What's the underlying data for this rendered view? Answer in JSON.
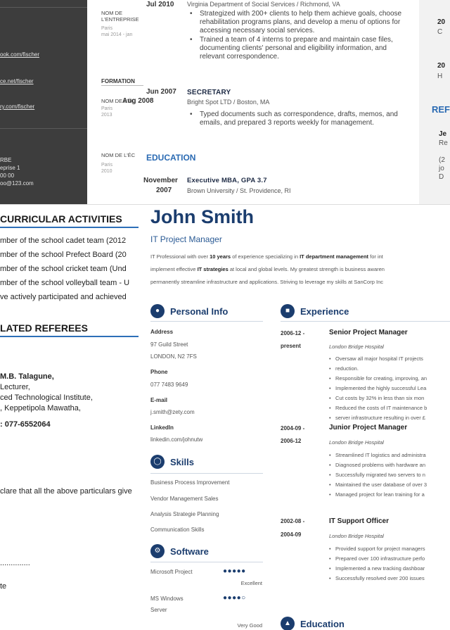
{
  "panel_a": {
    "links": [
      "ook.com/fischer",
      "ce.net/fischer",
      "ry.com/fischer"
    ],
    "address_lines": [
      "RBE",
      "eprise 1",
      "00 00",
      "oo@123.com"
    ]
  },
  "panel_b": {
    "job1": {
      "label": "NOM DE L'ENTREPRISE",
      "sub": [
        "Paris",
        "mai 2014 - jan"
      ],
      "date": "Jul 2010",
      "org": "Virginia Department of Social Services / Richmond, VA",
      "bullets": [
        "Strategized with 200+ clients to help them achieve goals, choose rehabilitation programs plans, and develop a menu of options for accessing necessary social services.",
        "Trained a team of 4 interns to prepare and maintain case files, documenting clients' personal and eligibility information, and relevant correspondence."
      ]
    },
    "formation_label": "FORMATION",
    "job2": {
      "label": "NOM DE L'ÉC",
      "sub": [
        "Paris",
        "2013"
      ],
      "date_start": "Jun 2007",
      "date_end": "Aug 2008",
      "title": "SECRETARY",
      "org": "Bright Spot LTD / Boston, MA",
      "bullets": [
        "Typed documents such as correspondence, drafts, memos, and emails, and prepared 3 reports weekly for management."
      ]
    },
    "edu": {
      "label": "NOM DE L'ÉC",
      "sub": [
        "Paris",
        "2010"
      ],
      "section": "EDUCATION",
      "date_start": "November",
      "date_end": "2007",
      "title": "Executive MBA, GPA 3.7",
      "org": "Brown University / St. Providence, RI"
    }
  },
  "panel_c": {
    "lines": [
      "20",
      "C",
      "20",
      "H",
      "REFE",
      "Je",
      "Re",
      "(2",
      "jo",
      "D"
    ]
  },
  "panel_d": {
    "activities_heading": "CURRICULAR ACTIVITIES",
    "activities": [
      "mber of the school cadet team (2012",
      "mber of the school Prefect Board (20",
      "mber of the school cricket team (Und",
      "mber of the school volleyball team - U",
      "ve actively participated and achieved"
    ],
    "referees_heading": "LATED REFEREES",
    "referee": {
      "name": "M.B. Talagune,",
      "lines": [
        "Lecturer,",
        "ced Technological Institute,",
        ", Keppetipola Mawatha,"
      ],
      "phone": ": 077-6552064"
    },
    "declaration": "clare that all the above particulars give",
    "dots": "..............",
    "date_label": "te"
  },
  "panel_e": {
    "name": "John Smith",
    "role": "IT Project Manager",
    "summary": [
      [
        "IT Professional with over ",
        "10 years",
        " of experience specializing in ",
        "IT department management",
        " for int"
      ],
      [
        "implement effective ",
        "IT strategies",
        " at local and global levels. My greatest strength is business awaren",
        "",
        ""
      ],
      [
        "permanently streamline infrastructure and applications. Striving to leverage my skills at SanCorp Inc",
        "",
        "",
        "",
        ""
      ]
    ],
    "personal": {
      "heading": "Personal Info",
      "address_label": "Address",
      "address_lines": [
        "97 Guild Street",
        "LONDON, N2 7FS"
      ],
      "phone_label": "Phone",
      "phone": "077 7483 9649",
      "email_label": "E-mail",
      "email": "j.smith@zety.com",
      "linkedin_label": "LinkedIn",
      "linkedin": "linkedin.com/johnutw"
    },
    "skills": {
      "heading": "Skills",
      "items": [
        "Business Process Improvement",
        "Vendor Management Sales",
        "Analysis Strategie Planning",
        "Communication Skills"
      ]
    },
    "software": {
      "heading": "Software",
      "items": [
        {
          "name": "Microsoft Project",
          "name2": "",
          "rating": 5,
          "level": "Excellent"
        },
        {
          "name": "MS Windows",
          "name2": "Server",
          "rating": 4,
          "level": "Very Good"
        }
      ]
    },
    "experience": {
      "heading": "Experience",
      "jobs": [
        {
          "date1": "2006-12 -",
          "date2": "present",
          "title": "Senior Project Manager",
          "company": "London Bridge Hospital",
          "bullets": [
            "Oversaw all major hospital IT projects",
            "reduction.",
            "Responsible for creating, improving, an",
            "Implemented the highly successful Lea",
            "Cut costs by 32% in less than six mon",
            "Reduced the costs of IT maintenance b",
            "server infrastructure resulting in over £"
          ]
        },
        {
          "date1": "2004-09 -",
          "date2": "2006-12",
          "title": "Junior Project Manager",
          "company": "London Bridge Hospital",
          "bullets": [
            "Streamlined IT logistics and administra",
            "Diagnosed problems with hardware an",
            "Successfully migrated two servers to n",
            "Maintained the user database of over 3",
            "Managed project for lean training for a"
          ]
        },
        {
          "date1": "2002-08 -",
          "date2": "2004-09",
          "title": "IT Support Officer",
          "company": "London Bridge Hospital",
          "bullets": [
            "Provided support for project managers",
            "Prepared over 100 infrastructure perfo",
            "Implemented a new tracking dashboar",
            "Successfully resolved over 200 issues"
          ]
        }
      ]
    },
    "education_heading": "Education"
  }
}
